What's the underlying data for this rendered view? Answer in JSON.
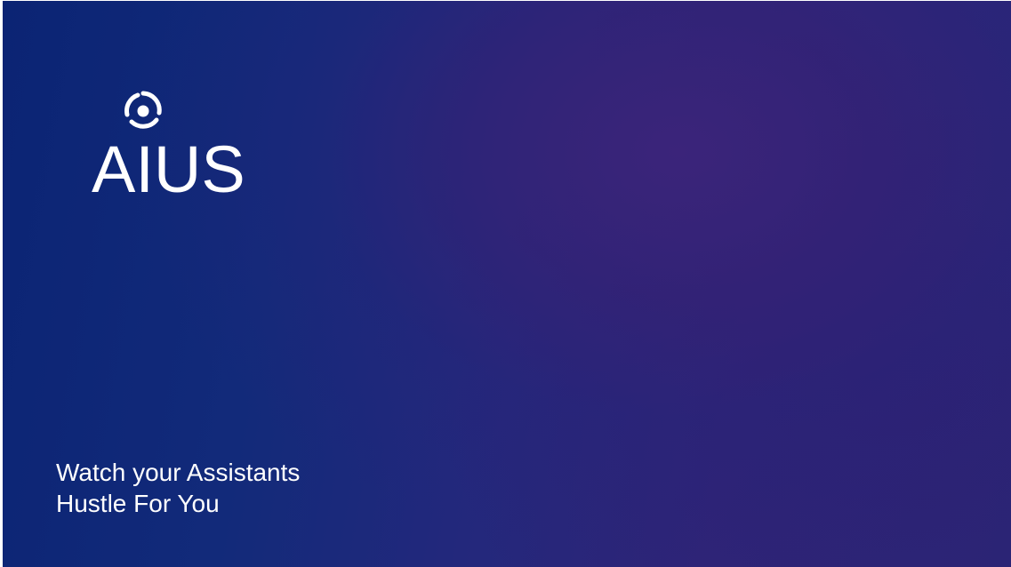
{
  "brand": {
    "logo_icon": "swirl-logo-icon",
    "name": "AIUS"
  },
  "tagline": {
    "line1": "Watch your Assistants",
    "line2": "Hustle For You"
  },
  "colors": {
    "background_start": "#0b2474",
    "background_purple": "#3c247a",
    "text": "#ffffff"
  }
}
